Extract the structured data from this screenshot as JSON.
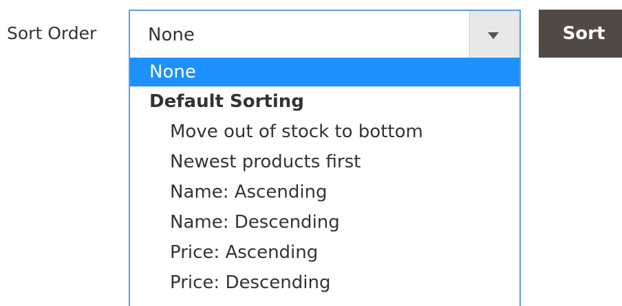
{
  "field": {
    "label": "Sort Order"
  },
  "select": {
    "value": "None",
    "arrow_icon": "chevron-down-icon"
  },
  "dropdown": {
    "selected_option": "None",
    "group_label": "Default Sorting",
    "options": [
      "Move out of stock to bottom",
      "Newest products first",
      "Name: Ascending",
      "Name: Descending",
      "Price: Ascending",
      "Price: Descending"
    ]
  },
  "sort_button": {
    "label": "Sort"
  },
  "colors": {
    "select_border": "#5f9bd5",
    "selected_option_bg": "#1e90ff",
    "button_bg": "#514943",
    "arrow_box_bg": "#e8e8e8"
  }
}
